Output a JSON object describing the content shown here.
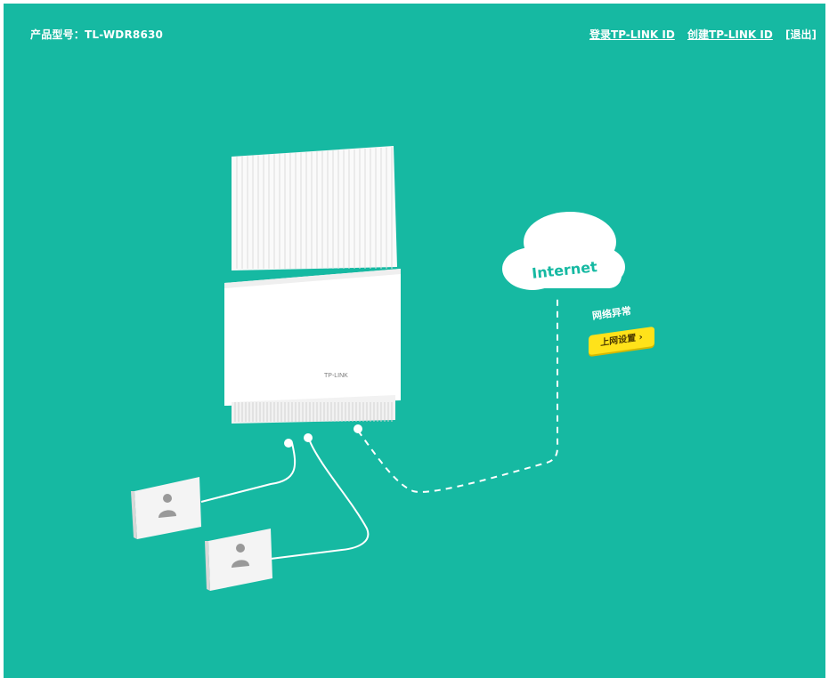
{
  "header": {
    "model": "产品型号：TL-WDR8630",
    "links": {
      "login": "登录TP-LINK ID",
      "create": "创建TP-LINK ID",
      "logout": "[退出]"
    }
  },
  "router": {
    "brand": "TP-LINK"
  },
  "internet": {
    "label": "Internet",
    "status": "网络异常",
    "setup_button": "上网设置 ›"
  },
  "devices": [
    {
      "icon": "user-icon"
    },
    {
      "icon": "user-icon"
    }
  ],
  "colors": {
    "background": "#16b9a2",
    "cloud_text": "#16b9a2",
    "setup_button": "#ffe21a"
  }
}
